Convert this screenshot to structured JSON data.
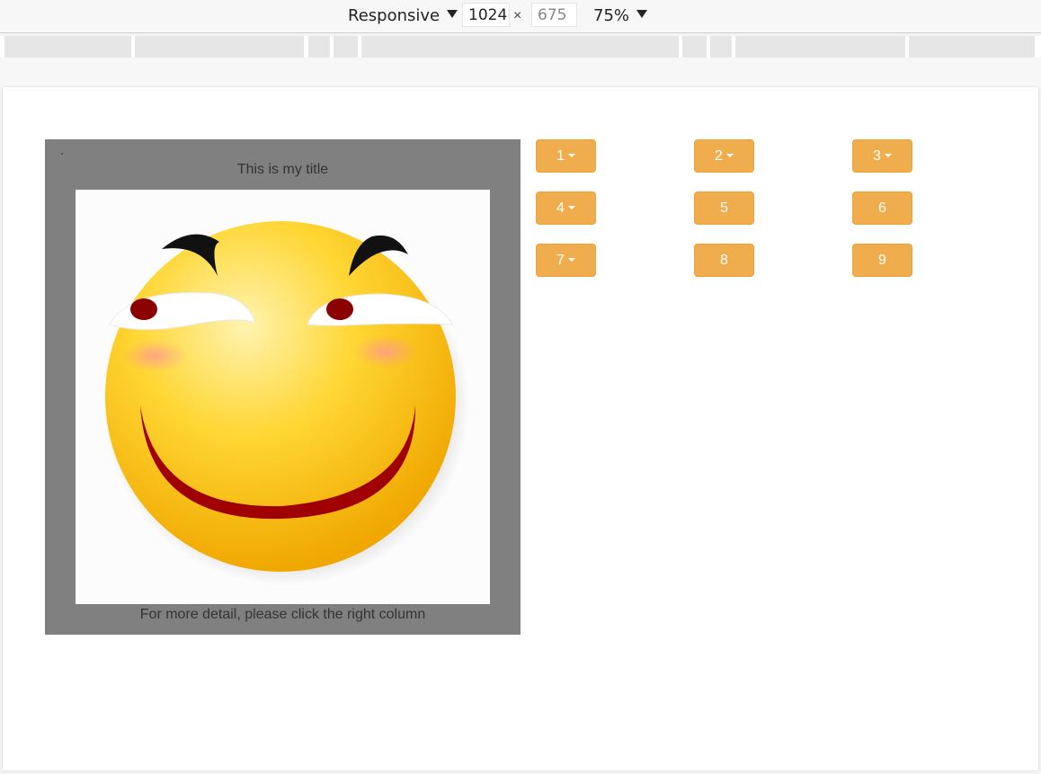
{
  "devtools": {
    "device_mode": "Responsive",
    "width_value": "1024",
    "height_placeholder": "675",
    "times_symbol": "×",
    "zoom": "75%"
  },
  "card": {
    "title": "This is my title",
    "caption": "For more detail, please click the right column",
    "image_alt": "smiling face emoji"
  },
  "buttons": [
    {
      "label": "1",
      "dropdown": true
    },
    {
      "label": "2",
      "dropdown": true
    },
    {
      "label": "3",
      "dropdown": true
    },
    {
      "label": "4",
      "dropdown": true
    },
    {
      "label": "5",
      "dropdown": false
    },
    {
      "label": "6",
      "dropdown": false
    },
    {
      "label": "7",
      "dropdown": true
    },
    {
      "label": "8",
      "dropdown": false
    },
    {
      "label": "9",
      "dropdown": false
    }
  ],
  "colors": {
    "button_bg": "#f0ad4e",
    "card_bg": "#808080"
  }
}
